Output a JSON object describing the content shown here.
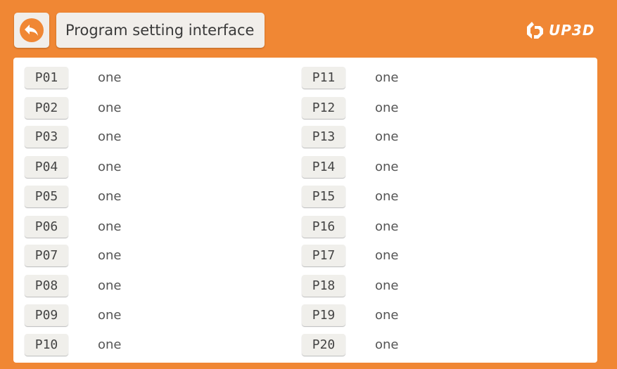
{
  "header": {
    "title": "Program setting interface",
    "logo_text": "UP3D",
    "back_icon": "back-arrow-icon"
  },
  "programs": {
    "left": [
      {
        "code": "P01",
        "name": "one"
      },
      {
        "code": "P02",
        "name": "one"
      },
      {
        "code": "P03",
        "name": "one"
      },
      {
        "code": "P04",
        "name": "one"
      },
      {
        "code": "P05",
        "name": "one"
      },
      {
        "code": "P06",
        "name": "one"
      },
      {
        "code": "P07",
        "name": "one"
      },
      {
        "code": "P08",
        "name": "one"
      },
      {
        "code": "P09",
        "name": "one"
      },
      {
        "code": "P10",
        "name": "one"
      }
    ],
    "right": [
      {
        "code": "P11",
        "name": "one"
      },
      {
        "code": "P12",
        "name": "one"
      },
      {
        "code": "P13",
        "name": "one"
      },
      {
        "code": "P14",
        "name": "one"
      },
      {
        "code": "P15",
        "name": "one"
      },
      {
        "code": "P16",
        "name": "one"
      },
      {
        "code": "P17",
        "name": "one"
      },
      {
        "code": "P18",
        "name": "one"
      },
      {
        "code": "P19",
        "name": "one"
      },
      {
        "code": "P20",
        "name": "one"
      }
    ]
  },
  "colors": {
    "accent": "#f08734",
    "button_bg": "#f0efeb",
    "panel_bg": "#ffffff"
  }
}
